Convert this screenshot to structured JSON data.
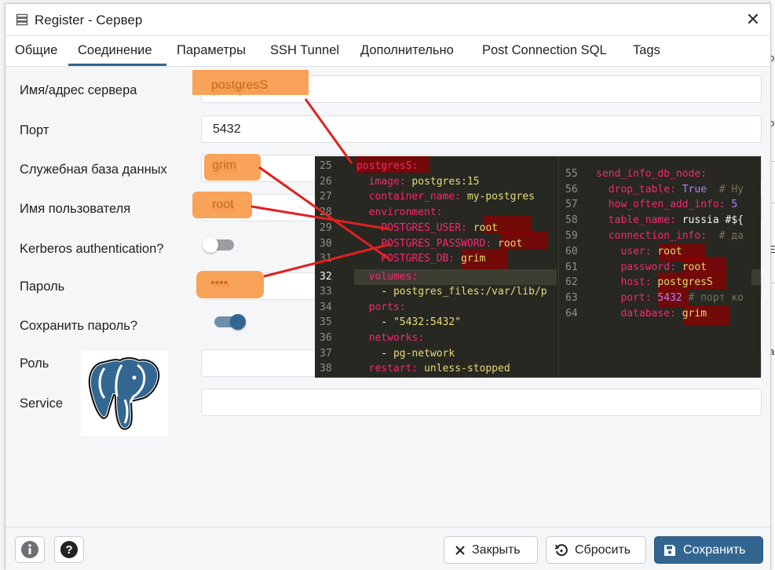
{
  "dialog": {
    "title": "Register - Сервер",
    "close_glyph": "✕"
  },
  "tabs": [
    {
      "label": "Общие"
    },
    {
      "label": "Соединение"
    },
    {
      "label": "Параметры"
    },
    {
      "label": "SSH Tunnel"
    },
    {
      "label": "Дополнительно"
    },
    {
      "label": "Post Connection SQL"
    },
    {
      "label": "Tags"
    }
  ],
  "active_tab": "Соединение",
  "form": {
    "host_label": "Имя/адрес сервера",
    "host_value": "postgresS",
    "port_label": "Порт",
    "port_value": "5432",
    "maintenance_db_label": "Служебная база данных",
    "maintenance_db_value": "grim",
    "username_label": "Имя пользователя",
    "username_value": "root",
    "kerberos_label": "Kerberos authentication?",
    "kerberos_on": false,
    "password_label": "Пароль",
    "password_value": "••••",
    "save_password_label": "Сохранить пароль?",
    "save_password_on": true,
    "role_label": "Роль",
    "role_value": "",
    "service_label": "Service",
    "service_value": ""
  },
  "code_overlay": {
    "left_lines": [
      {
        "no": "25",
        "text": "postgresS:"
      },
      {
        "no": "26",
        "key": "image:",
        "val": "postgres:15"
      },
      {
        "no": "27",
        "key": "container_name:",
        "val": "my-postgres"
      },
      {
        "no": "28",
        "key": "environment:",
        "val": ""
      },
      {
        "no": "29",
        "key": "POSTGRES_USER:",
        "val": "root"
      },
      {
        "no": "30",
        "key": "POSTGRES_PASSWORD:",
        "val": "root"
      },
      {
        "no": "31",
        "key": "POSTGRES_DB:",
        "val": "grim"
      },
      {
        "no": "32",
        "key": "volumes:",
        "val": ""
      },
      {
        "no": "33",
        "key": "- ",
        "val": "postgres_files:/var/lib/p"
      },
      {
        "no": "34",
        "key": "ports:",
        "val": ""
      },
      {
        "no": "35",
        "key": "- ",
        "val": "\"5432:5432\""
      },
      {
        "no": "36",
        "key": "networks:",
        "val": ""
      },
      {
        "no": "37",
        "key": "- ",
        "val": "pg-network"
      },
      {
        "no": "38",
        "key": "restart:",
        "val": "unless-stopped"
      }
    ],
    "right_lines": [
      {
        "no": "55",
        "key": "send_info_db_node:",
        "val": "",
        "cmt": ""
      },
      {
        "no": "56",
        "key": "drop_table:",
        "val": "True",
        "cmt": "# Ну"
      },
      {
        "no": "57",
        "key": "how_often_add_info:",
        "val": "5",
        "cmt": ""
      },
      {
        "no": "58",
        "key": "table_name:",
        "val": "russia #${",
        "cmt": ""
      },
      {
        "no": "59",
        "key": "connection_info:",
        "val": "",
        "cmt": "# да"
      },
      {
        "no": "60",
        "key": "user:",
        "val": "root",
        "cmt": ""
      },
      {
        "no": "61",
        "key": "password:",
        "val": "root",
        "cmt": ""
      },
      {
        "no": "62",
        "key": "host:",
        "val": "postgresS",
        "cmt": ""
      },
      {
        "no": "63",
        "key": "port:",
        "val": "5432",
        "cmt": "# порт ко"
      },
      {
        "no": "64",
        "key": "database:",
        "val": "grim",
        "cmt": ""
      }
    ]
  },
  "footer": {
    "info_icon": "info-icon",
    "help_icon": "help-icon",
    "close_label": "Закрыть",
    "reset_label": "Сбросить",
    "save_label": "Сохранить"
  },
  "colors": {
    "accent": "#326690",
    "highlight": "#f79a4c",
    "annotation_red": "#e02020",
    "code_bg": "#272822"
  },
  "background": {
    "fragments": [
      "о",
      "о",
      "Е",
      "а"
    ]
  }
}
